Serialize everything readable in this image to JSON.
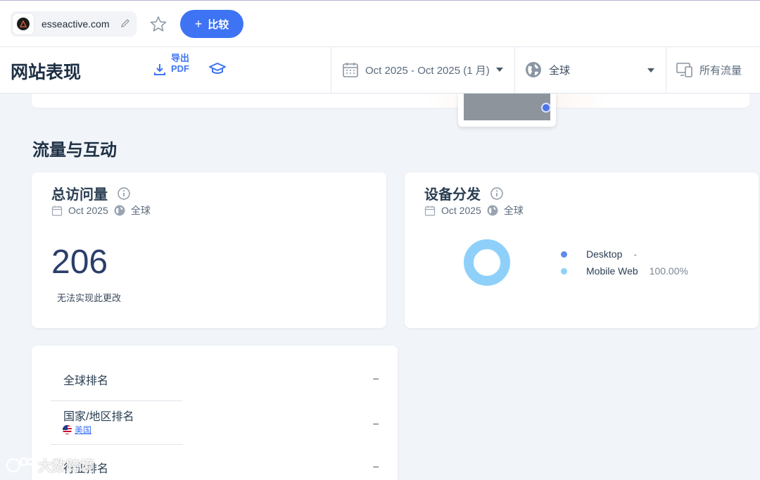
{
  "topbar": {
    "domain": "esseactive.com",
    "compare_label": "比较",
    "compare_plus": "+"
  },
  "header": {
    "title": "网站表现",
    "export_pdf": "导出 PDF",
    "date_range": "Oct 2025 - Oct 2025 (1 月)",
    "region": "全球",
    "traffic": "所有流量"
  },
  "section": {
    "title": "流量与互动"
  },
  "visits_card": {
    "title": "总访问量",
    "date": "Oct 2025",
    "region": "全球",
    "total": "206",
    "note": "无法实现此更改"
  },
  "device_card": {
    "title": "设备分发",
    "date": "Oct 2025",
    "region": "全球",
    "legend": [
      {
        "label": "Desktop",
        "value": "-",
        "color": "#5b8def"
      },
      {
        "label": "Mobile Web",
        "value": "100.00%",
        "color": "#8fd0fb"
      }
    ]
  },
  "chart_data": {
    "type": "pie",
    "categories": [
      "Desktop",
      "Mobile Web"
    ],
    "values": [
      0,
      100
    ],
    "colors": [
      "#5b8def",
      "#8fd0fb"
    ],
    "donut": true
  },
  "rank_card": {
    "rows": [
      {
        "label": "全球排名",
        "value": "–"
      },
      {
        "label": "国家/地区排名",
        "value": "–",
        "link": "美国"
      },
      {
        "label": "行业排名",
        "value": "–"
      }
    ]
  },
  "watermark": "大数跨境"
}
